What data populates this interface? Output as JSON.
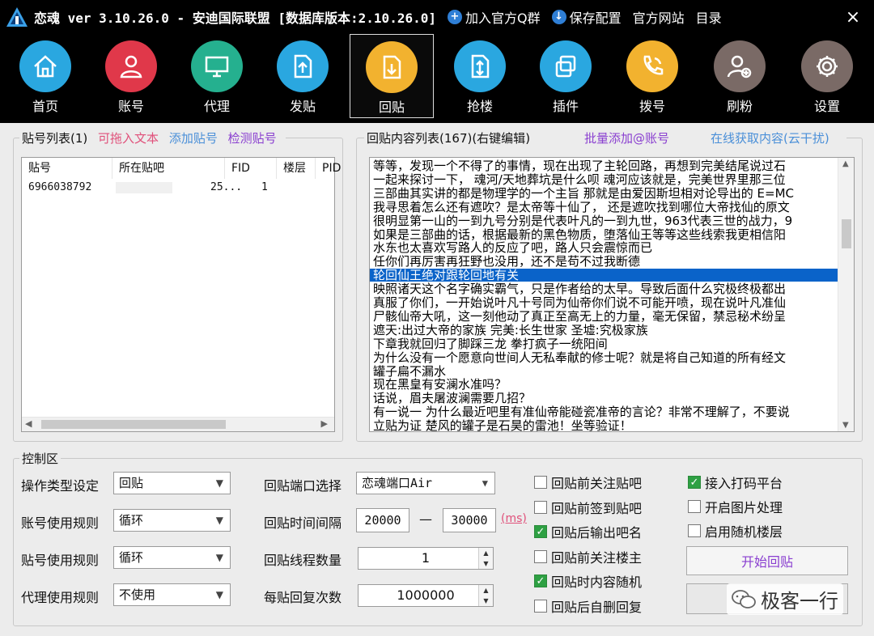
{
  "window": {
    "title": "恋魂 ver 3.10.26.0 - 安迪国际联盟 [数据库版本:2.10.26.0]",
    "links": [
      {
        "label": "加入官方Q群",
        "icon": "plus-circle-icon"
      },
      {
        "label": "保存配置",
        "icon": "download-arrow-icon"
      },
      {
        "label": "官方网站"
      },
      {
        "label": "目录"
      }
    ]
  },
  "toolbar": {
    "items": [
      {
        "label": "首页",
        "icon": "home-icon",
        "color": "#2aa7e0"
      },
      {
        "label": "账号",
        "icon": "user-icon",
        "color": "#e0384a"
      },
      {
        "label": "代理",
        "icon": "monitor-icon",
        "color": "#25b08f"
      },
      {
        "label": "发贴",
        "icon": "upload-icon",
        "color": "#2aa7e0"
      },
      {
        "label": "回贴",
        "icon": "reply-icon",
        "color": "#f2b22f"
      },
      {
        "label": "抢楼",
        "icon": "building-icon",
        "color": "#2aa7e0"
      },
      {
        "label": "插件",
        "icon": "plugin-icon",
        "color": "#2aa7e0"
      },
      {
        "label": "拨号",
        "icon": "phone-icon",
        "color": "#f2b22f"
      },
      {
        "label": "刷粉",
        "icon": "add-user-icon",
        "color": "#7a6a66"
      },
      {
        "label": "设置",
        "icon": "gear-icon",
        "color": "#7a6a66"
      }
    ],
    "active": "回贴"
  },
  "account_panel": {
    "title": "贴号列表(1)",
    "actions": [
      "可拖入文本",
      "添加贴号",
      "检测贴号"
    ],
    "columns": [
      "贴号",
      "所在贴吧",
      "FID",
      "楼层",
      "PID"
    ],
    "rows": [
      [
        "6966038792",
        "",
        "25...",
        "1",
        ""
      ]
    ]
  },
  "reply_panel": {
    "title": "回贴内容列表(167)(右键编辑)",
    "actions": [
      "批量添加@账号",
      "在线获取内容(云干扰)"
    ],
    "lines": [
      "等等，发现一个不得了的事情，现在出现了主轮回路，再想到完美结尾说过石",
      "一起来探讨一下，  魂河/天地葬坑是什么呗 魂河应该就是，完美世界里那三位",
      "三部曲其实讲的都是物理学的一个主旨 那就是由爱因斯坦相对论导出的 E=MC",
      "我寻思着怎么还有遮吹？是太帝等十仙了，  还是遮吹找到哪位大帝找仙的原文",
      "很明显第一山的一到九号分别是代表叶凡的一到九世，963代表三世的战力，9",
      "如果是三部曲的话，根据最新的黑色物质，堕落仙王等等这些线索我更相信阳",
      "水东也太喜欢写路人的反应了吧，路人只会震惊而已",
      "任你们再厉害再狂野也没用，还不是苟不过我断德",
      "轮回仙王绝对跟轮回地有关",
      "映照诸天这个名字确实霸气，只是作者给的太早。导致后面什么究极终极都出",
      "真服了你们，一开始说叶凡十号同为仙帝你们说不可能开喷，现在说叶凡准仙",
      "尸骸仙帝大吼，这一刻他动了真正至高无上的力量，毫无保留，禁忌秘术纷呈",
      "遮天:出过大帝的家族 完美:长生世家 圣墟:究极家族",
      "下章我就回归了脚踩三龙 拳打疯子一统阳间",
      "为什么没有一个愿意向世间人无私奉献的修士呢？就是将自己知道的所有经文",
      "罐子扁不漏水",
      "现在黑皇有安澜水准吗？",
      "话说，眉夫屠波澜需要几招？",
      "有一说一 为什么最近吧里有准仙帝能碰瓷准帝的言论？非常不理解了，不要说",
      "立贴为证 楚风的罐子是石昊的雷池！坐等验证！"
    ],
    "selected_index": 8
  },
  "control": {
    "title": "控制区",
    "fields": [
      {
        "label": "操作类型设定",
        "value": "回贴"
      },
      {
        "label": "账号使用规则",
        "value": "循环"
      },
      {
        "label": "贴号使用规则",
        "value": "循环"
      },
      {
        "label": "代理使用规则",
        "value": "不使用"
      }
    ],
    "port_label": "回贴端口选择",
    "port_value": "恋魂端口Air",
    "interval_label": "回贴时间间隔",
    "interval_min": "20000",
    "interval_sep": "—",
    "interval_max": "30000",
    "interval_unit": "(ms)",
    "threads_label": "回贴线程数量",
    "threads_value": "1",
    "replies_label": "每贴回复次数",
    "replies_value": "1000000",
    "checks_left": [
      {
        "label": "回贴前关注贴吧",
        "checked": false
      },
      {
        "label": "回贴前签到贴吧",
        "checked": false
      },
      {
        "label": "回贴后输出吧名",
        "checked": true
      },
      {
        "label": "回贴前关注楼主",
        "checked": false
      },
      {
        "label": "回贴时内容随机",
        "checked": true
      },
      {
        "label": "回贴后自删回复",
        "checked": false
      }
    ],
    "checks_right": [
      {
        "label": "接入打码平台",
        "checked": true
      },
      {
        "label": "开启图片处理",
        "checked": false
      },
      {
        "label": "启用随机楼层",
        "checked": false
      }
    ],
    "start_button": "开始回贴"
  },
  "watermark": "极客一行",
  "colors": {
    "link_pink": "#e0507a",
    "link_blue": "#4a8fd8",
    "link_purple": "#8a3fd0",
    "selection": "#0a63c9",
    "checkbox_on": "#2ea043"
  }
}
